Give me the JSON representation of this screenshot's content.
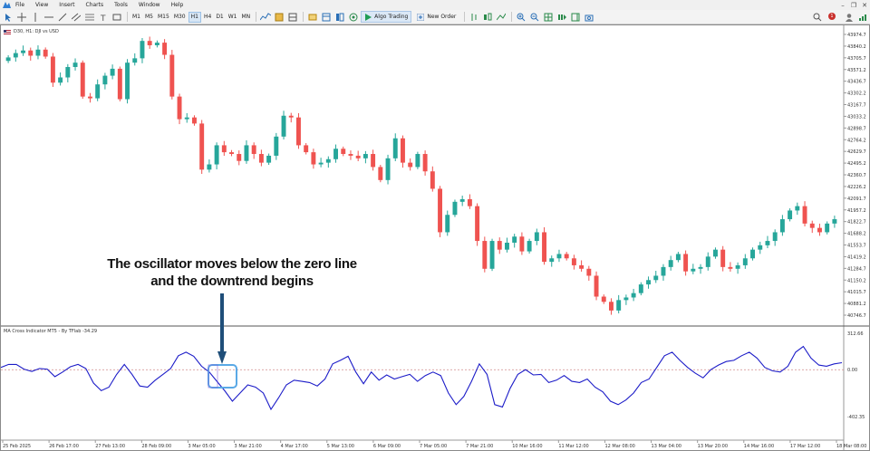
{
  "menu": [
    "File",
    "View",
    "Insert",
    "Charts",
    "Tools",
    "Window",
    "Help"
  ],
  "toolbar": {
    "timeframes": [
      "M1",
      "M5",
      "M15",
      "M30",
      "H1",
      "H4",
      "D1",
      "W1",
      "MN"
    ],
    "active_timeframe": "H1",
    "algo_trading": "Algo Trading",
    "new_order": "New Order",
    "notification_count": "1"
  },
  "chart": {
    "symbol_label": "D30, H1:  DJI vs USD",
    "indicator_label": "MA Cross Indicator MT5 - By TFlab -34.29",
    "annotation_line1": "The oscillator moves below the zero line",
    "annotation_line2": "and the downtrend begins",
    "colors": {
      "bull": "#26a69a",
      "bear": "#ef5350",
      "oscillator": "#1c1cc8",
      "zero_line": "#d08a8a",
      "highlight_box": "#5aa9e6",
      "arrow": "#1f4e79"
    }
  },
  "chart_data": {
    "type": "candlestick",
    "price_axis_ticks": [
      "43974.7",
      "43840.2",
      "43705.7",
      "43571.2",
      "43436.7",
      "43302.2",
      "43167.7",
      "43033.2",
      "42898.7",
      "42764.2",
      "42629.7",
      "42495.2",
      "42360.7",
      "42226.2",
      "42091.7",
      "41957.2",
      "41822.7",
      "41688.2",
      "41553.7",
      "41419.2",
      "41284.7",
      "41150.2",
      "41015.7",
      "40881.2",
      "40746.7"
    ],
    "indicator_axis_ticks": [
      "312.66",
      "0.00",
      "-402.35"
    ],
    "time_axis_labels": [
      "25 Feb 2025",
      "26 Feb 17:00",
      "27 Feb 13:00",
      "28 Feb 09:00",
      "3 Mar 05:00",
      "3 Mar 21:00",
      "4 Mar 17:00",
      "5 Mar 13:00",
      "6 Mar 09:00",
      "7 Mar 05:00",
      "7 Mar 21:00",
      "10 Mar 16:00",
      "11 Mar 12:00",
      "12 Mar 08:00",
      "13 Mar 04:00",
      "13 Mar 20:00",
      "14 Mar 16:00",
      "17 Mar 12:00",
      "18 Mar 08:00"
    ],
    "close_series": [
      43710,
      43760,
      43790,
      43730,
      43800,
      43720,
      43420,
      43480,
      43600,
      43650,
      43260,
      43240,
      43400,
      43500,
      43580,
      43230,
      43650,
      43700,
      43900,
      43850,
      43880,
      43740,
      43260,
      43000,
      43020,
      42950,
      42420,
      42480,
      42700,
      42620,
      42600,
      42520,
      42700,
      42600,
      42500,
      42580,
      42800,
      43040,
      43020,
      42700,
      42620,
      42480,
      42500,
      42540,
      42660,
      42600,
      42580,
      42550,
      42600,
      42450,
      42300,
      42550,
      42780,
      42500,
      42450,
      42600,
      42400,
      42200,
      41700,
      41900,
      42050,
      42080,
      42000,
      41600,
      41280,
      41600,
      41500,
      41580,
      41650,
      41480,
      41600,
      41700,
      41360,
      41400,
      41450,
      41400,
      41320,
      41280,
      41200,
      40960,
      40900,
      40800,
      40920,
      40950,
      41000,
      41100,
      41150,
      41200,
      41300,
      41380,
      41450,
      41250,
      41280,
      41300,
      41420,
      41500,
      41300,
      41280,
      41320,
      41400,
      41500,
      41550,
      41600,
      41700,
      41850,
      41950,
      42000,
      41800,
      41750,
      41700,
      41800,
      41850
    ],
    "oscillator_series": [
      20,
      45,
      45,
      5,
      -15,
      10,
      5,
      -60,
      -20,
      25,
      45,
      10,
      -115,
      -180,
      -150,
      -40,
      45,
      -40,
      -140,
      -150,
      -90,
      -40,
      10,
      120,
      150,
      115,
      30,
      -20,
      -100,
      -180,
      -270,
      -200,
      -130,
      -150,
      -200,
      -340,
      -240,
      -130,
      -90,
      -100,
      -110,
      -140,
      -80,
      50,
      80,
      115,
      -20,
      -120,
      -20,
      -90,
      -45,
      -80,
      -60,
      -40,
      -100,
      -50,
      -20,
      -50,
      -200,
      -300,
      -230,
      -100,
      50,
      -40,
      -300,
      -320,
      -160,
      -40,
      0,
      -45,
      -40,
      -110,
      -90,
      -50,
      -100,
      -110,
      -80,
      -150,
      -190,
      -270,
      -300,
      -260,
      -200,
      -110,
      -80,
      20,
      120,
      150,
      80,
      20,
      -30,
      -70,
      0,
      40,
      70,
      80,
      120,
      150,
      100,
      20,
      -10,
      -20,
      30,
      150,
      200,
      100,
      40,
      30,
      50,
      60
    ],
    "zero_line": 0
  }
}
